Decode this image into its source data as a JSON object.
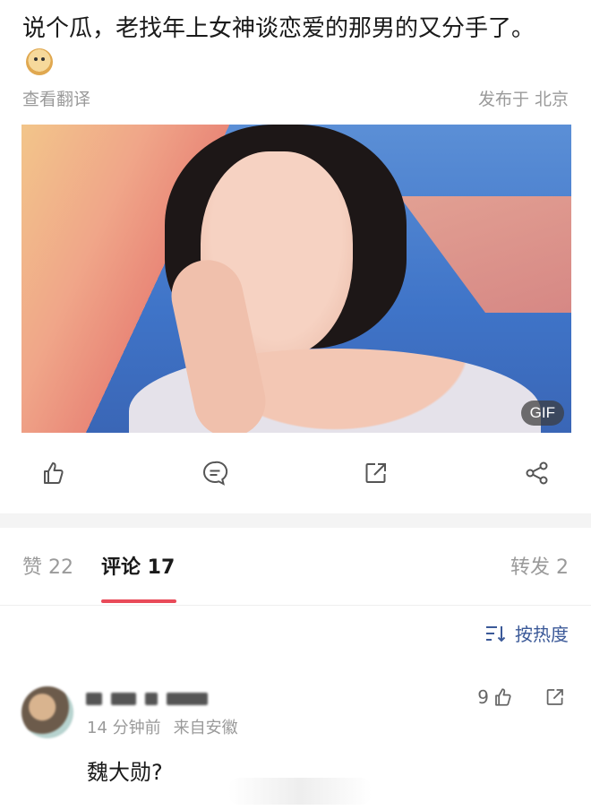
{
  "post": {
    "text": "说个瓜，老找年上女神谈恋爱的那男的又分手了。",
    "emoji_icon": "doge-icon",
    "translate_label": "查看翻译",
    "location_label": "发布于 北京",
    "media_badge": "GIF"
  },
  "actions": {
    "like_icon": "thumb-up-icon",
    "comment_icon": "comment-bubble-icon",
    "repost_icon": "repost-icon",
    "share_icon": "share-icon"
  },
  "tabs": {
    "like_label": "赞 22",
    "comment_label": "评论 17",
    "repost_label": "转发 2",
    "active_color": "#e94a59"
  },
  "sort": {
    "label": "按热度",
    "icon": "sort-icon",
    "color": "#3b5998"
  },
  "comment": {
    "time": "14 分钟前",
    "location": "来自安徽",
    "like_count": "9",
    "text": "魏大勋?"
  }
}
